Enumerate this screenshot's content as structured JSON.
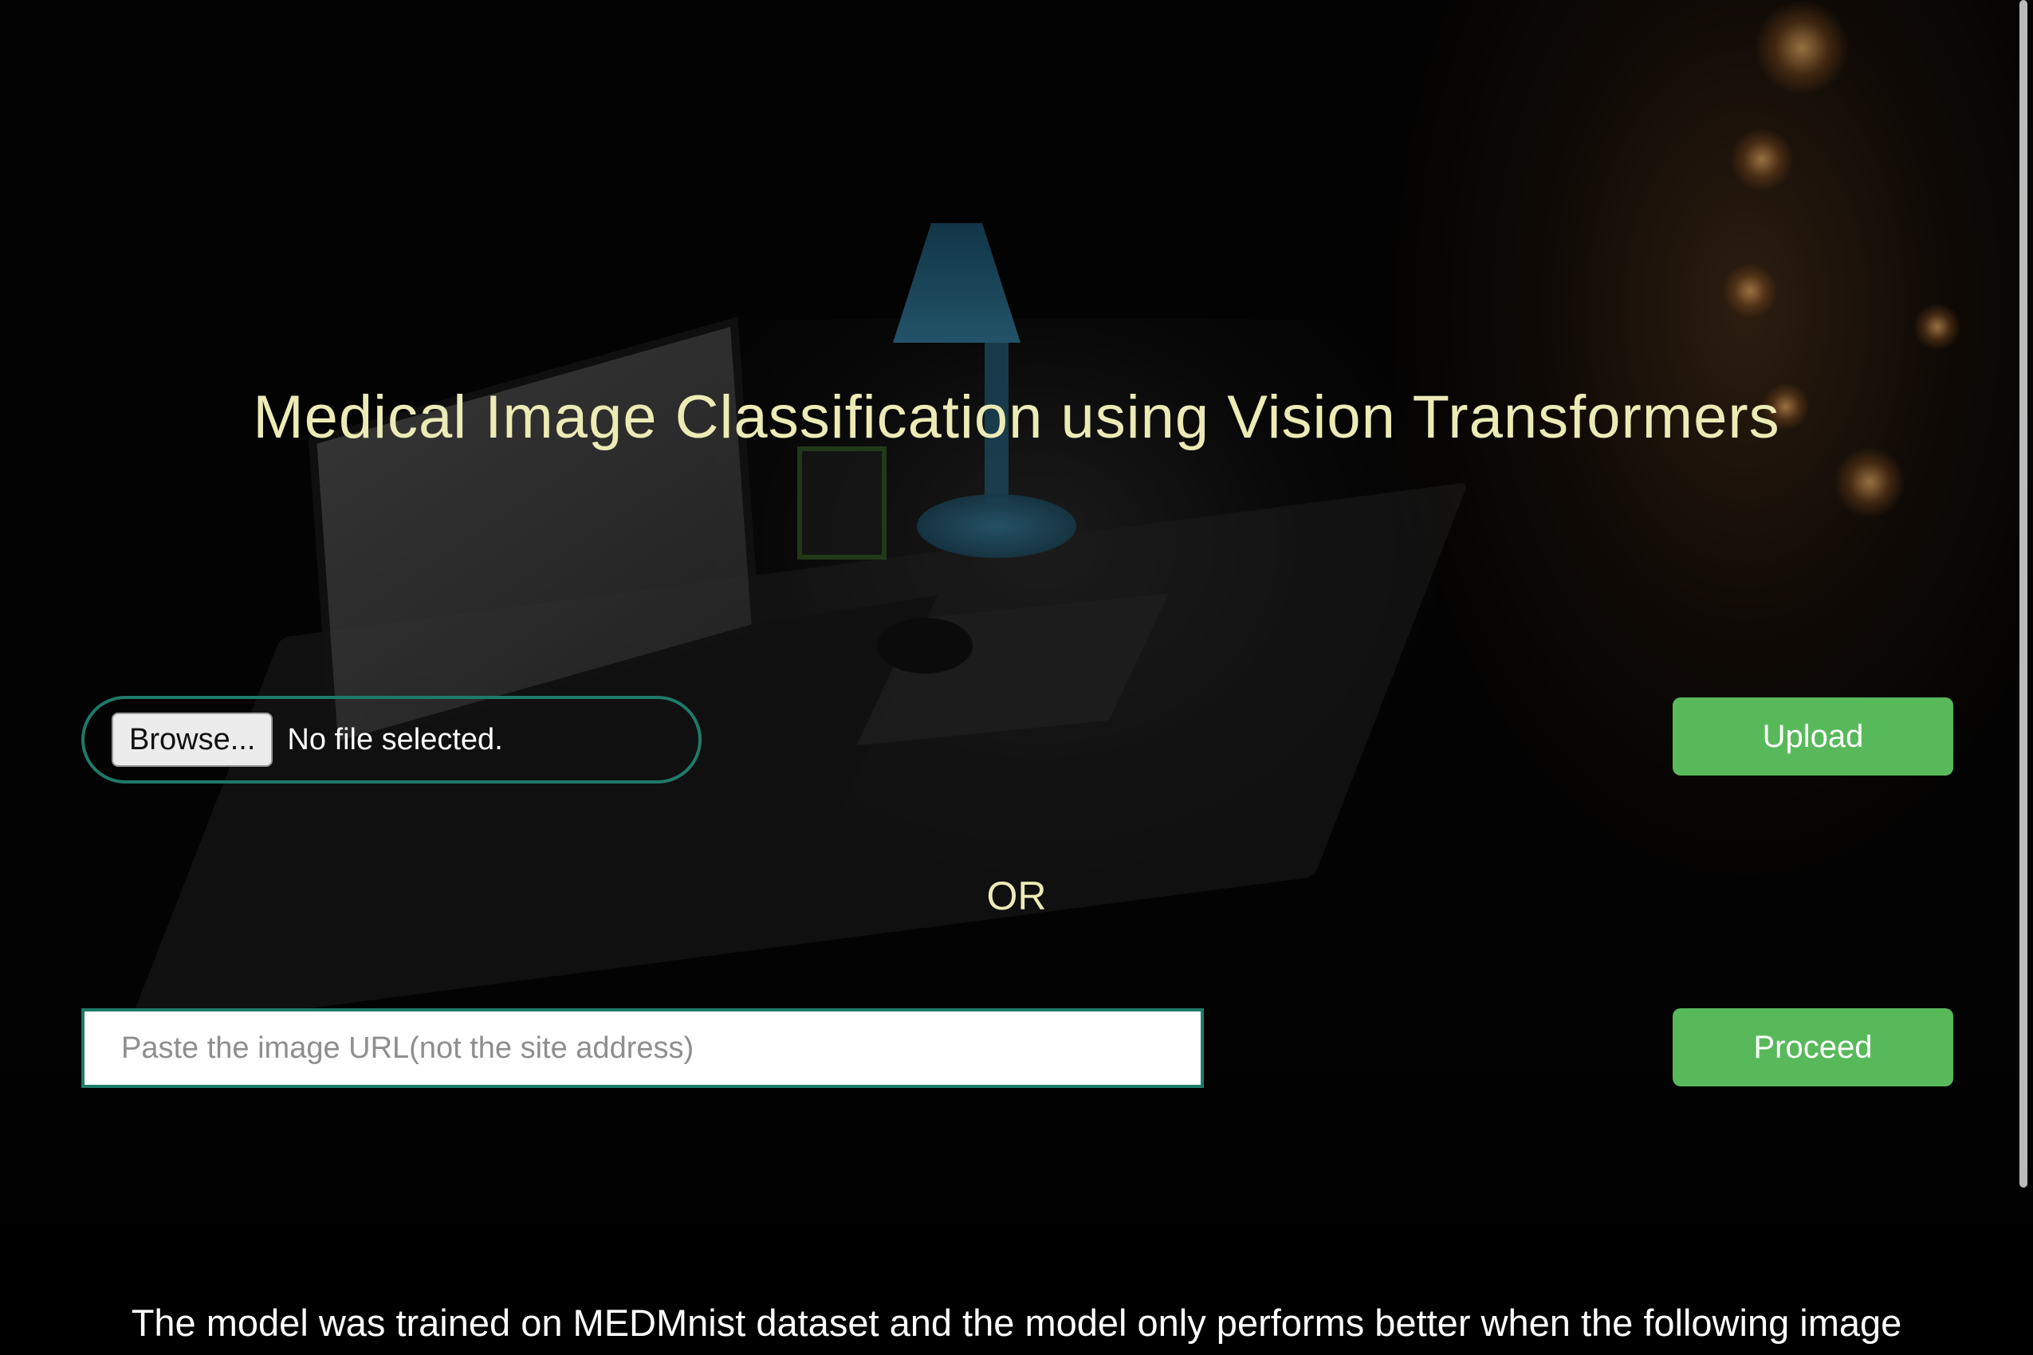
{
  "header": {
    "title": "Medical Image Classification using Vision Transformers"
  },
  "file_upload": {
    "browse_label": "Browse...",
    "status": "No file selected.",
    "upload_label": "Upload"
  },
  "divider": {
    "label": "OR"
  },
  "url_section": {
    "placeholder": "Paste the image URL(not the site address)",
    "value": "",
    "proceed_label": "Proceed"
  },
  "footer": {
    "text": "The model was trained on MEDMnist dataset and the model only performs better when the following image"
  },
  "colors": {
    "accent_green": "#58b95a",
    "title_yellow": "#ecebb5",
    "border_teal": "#1f7a6a"
  }
}
